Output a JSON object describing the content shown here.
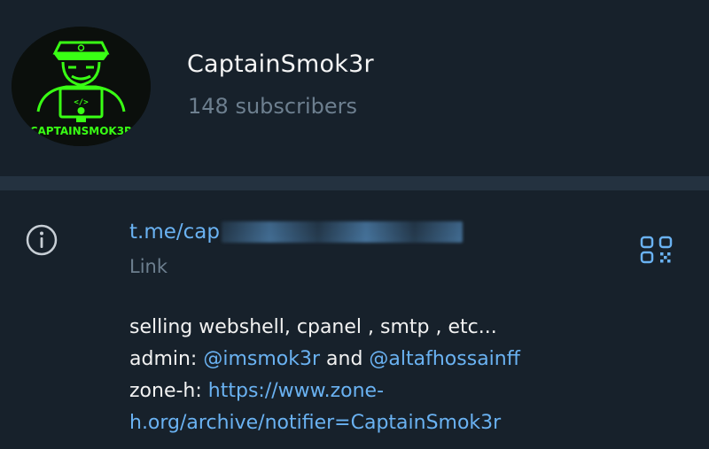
{
  "channel": {
    "name": "CaptainSmok3r",
    "subscribers": "148 subscribers",
    "avatar_text": "CAPTAINSMOK3R"
  },
  "info": {
    "link_visible_prefix": "t.me/cap",
    "link_label": "Link",
    "description": {
      "line1": "selling webshell, cpanel , smtp , etc...",
      "line2_prefix": "admin: ",
      "admin1": "@imsmok3r",
      "line2_mid": " and ",
      "admin2": "@altafhossainff",
      "line3_prefix": "zone-h: ",
      "zone_url_part1": "https://www.zone-",
      "zone_url_part2": "h.org/archive/notifier=CaptainSmok3r"
    }
  },
  "icons": {
    "info": "info-circle-icon",
    "qr": "qr-code-icon"
  },
  "colors": {
    "background": "#17212b",
    "separator": "#243240",
    "link": "#6ab2f2",
    "secondary_text": "#6d7f8f",
    "avatar_green": "#39ff14"
  }
}
